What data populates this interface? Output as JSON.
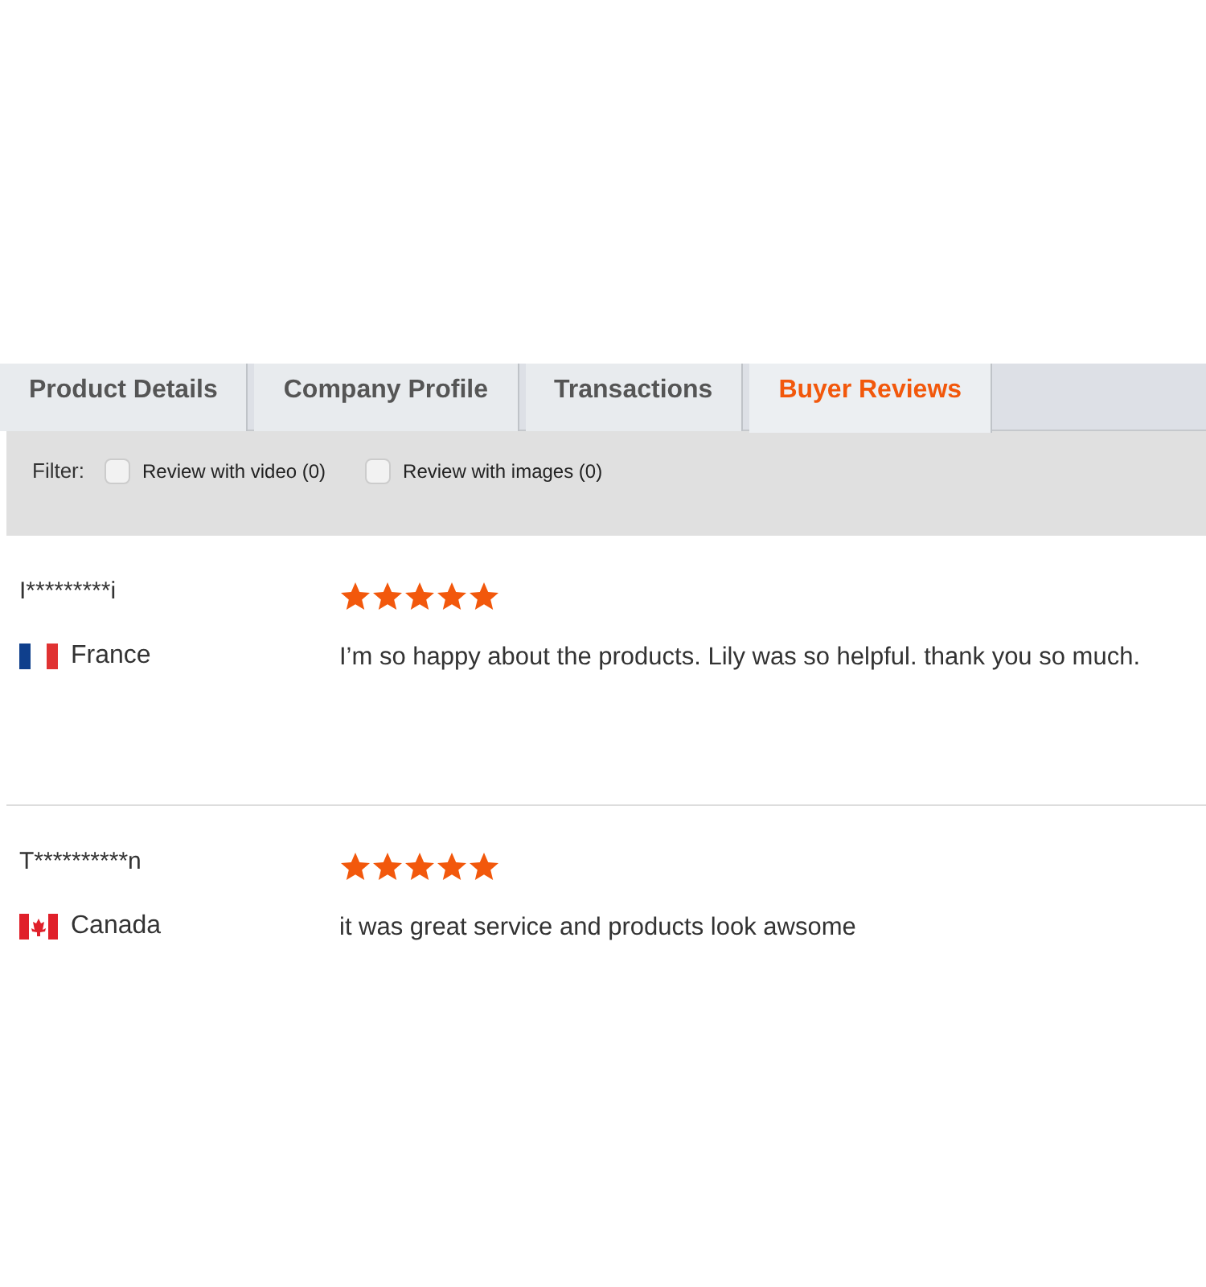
{
  "tabs": [
    {
      "label": "Product Details",
      "selected": false
    },
    {
      "label": "Company Profile",
      "selected": false
    },
    {
      "label": "Transactions",
      "selected": false
    },
    {
      "label": "Buyer Reviews",
      "selected": true
    }
  ],
  "filter": {
    "label": "Filter:",
    "options": [
      {
        "label": "Review with video (0)",
        "checked": false
      },
      {
        "label": "Review with images (0)",
        "checked": false
      }
    ]
  },
  "reviews": [
    {
      "buyer": "I*********i",
      "kind": "fr",
      "country": "France",
      "stars": 5,
      "text": "I’m so happy about the products. Lily was so helpful. thank you so much."
    },
    {
      "buyer": "T**********n",
      "kind": "ca",
      "country": "Canada",
      "stars": 5,
      "text": "it was great service and products look awsome"
    }
  ]
}
